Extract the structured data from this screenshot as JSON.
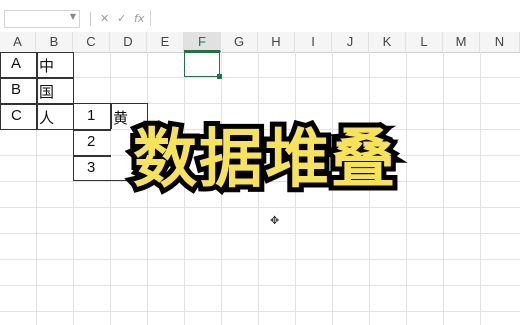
{
  "formula_bar": {
    "name_box_value": "",
    "name_box_dropdown_icon": "chevron-down-icon",
    "cancel_icon": "✕",
    "confirm_icon": "✓",
    "fx_label": "fx",
    "formula_value": ""
  },
  "columns": [
    "A",
    "B",
    "C",
    "D",
    "E",
    "F",
    "G",
    "H",
    "I",
    "J",
    "K",
    "L",
    "M",
    "N"
  ],
  "cells": {
    "A1": "A",
    "B1": "中",
    "A2": "B",
    "B2": "国",
    "A3": "C",
    "B3": "人",
    "C3": "1",
    "D3": "黄",
    "C4": "2",
    "C5": "3"
  },
  "overlay_title": "数据堆叠",
  "colors": {
    "accent": "#217346",
    "title_fill": "#f7e35a",
    "title_stroke": "#000000"
  }
}
